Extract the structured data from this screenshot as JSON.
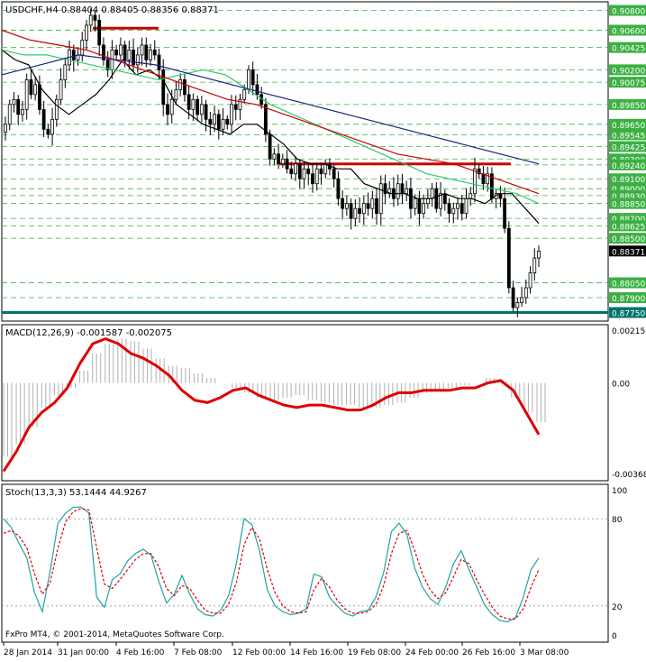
{
  "colors": {
    "background": "#ffffff",
    "frame": "#000000",
    "grid_h": "#3cb043",
    "candle": "#000000",
    "ma_fast": "#000000",
    "ma_green": "#2ecc71",
    "ma_red": "#cc0000",
    "ma_blue": "#1a237e",
    "support_line": "#00736e",
    "price_box": "#000000",
    "macd_hist": "#b0b0b0",
    "macd_signal": "#e00000",
    "stoch_main": "#1fa3a3",
    "stoch_signal": "#e00000",
    "hline": "#cc0000"
  },
  "main": {
    "header": "USDCHF,H4  0.88404 0.88405 0.88356 0.88371",
    "price_labels": [
      "0.90800",
      "0.90600",
      "0.90425",
      "0.90200",
      "0.90075",
      "0.89850",
      "0.89650",
      "0.89545",
      "0.89425",
      "0.89300",
      "0.89240",
      "0.89100",
      "0.89000",
      "0.88930",
      "0.88850",
      "0.88700",
      "0.88625",
      "0.88500",
      "0.88371",
      "0.88050",
      "0.87900",
      "0.87750"
    ],
    "current_price": "0.88371",
    "support_price": "0.87750"
  },
  "macd": {
    "header": "MACD(12,26,9) -0.001587 -0.002075",
    "labels": [
      "0.002153",
      "0.00",
      "-0.003688"
    ]
  },
  "stoch": {
    "header": "Stoch(13,3,3) 53.1444 44.9267",
    "labels": [
      "100",
      "80",
      "20",
      "0"
    ],
    "footer": "FxPro MT4, © 2001-2014, MetaQuotes Software Corp."
  },
  "time_axis": [
    "28 Jan 2014",
    "31 Jan 00:00",
    "4 Feb 16:00",
    "7 Feb 08:00",
    "12 Feb 00:00",
    "14 Feb 16:00",
    "19 Feb 08:00",
    "24 Feb 00:00",
    "26 Feb 16:00",
    "3 Mar 08:00"
  ],
  "chart_data": [
    {
      "type": "candlestick",
      "title": "USDCHF,H4",
      "x_ticks": [
        "28 Jan 2014",
        "31 Jan 00:00",
        "4 Feb 16:00",
        "7 Feb 08:00",
        "12 Feb 00:00",
        "14 Feb 16:00",
        "19 Feb 08:00",
        "24 Feb 00:00",
        "26 Feb 16:00",
        "3 Mar 08:00"
      ],
      "ylim": [
        0.877,
        0.9085
      ],
      "close": [
        0.8965,
        0.8985,
        0.899,
        0.8975,
        0.898,
        0.901,
        0.8995,
        0.9005,
        0.898,
        0.896,
        0.8955,
        0.897,
        0.899,
        0.901,
        0.9025,
        0.904,
        0.903,
        0.9035,
        0.905,
        0.9065,
        0.9075,
        0.907,
        0.9045,
        0.903,
        0.902,
        0.904,
        0.9035,
        0.9045,
        0.903,
        0.904,
        0.9025,
        0.9035,
        0.9045,
        0.903,
        0.904,
        0.9035,
        0.902,
        0.8985,
        0.8975,
        0.899,
        0.9,
        0.901,
        0.8995,
        0.898,
        0.899,
        0.8975,
        0.8985,
        0.897,
        0.8965,
        0.8975,
        0.896,
        0.897,
        0.8965,
        0.8985,
        0.898,
        0.899,
        0.9,
        0.902,
        0.9005,
        0.8995,
        0.8985,
        0.8955,
        0.893,
        0.8935,
        0.8925,
        0.893,
        0.892,
        0.8915,
        0.8925,
        0.891,
        0.892,
        0.8915,
        0.8905,
        0.892,
        0.8915,
        0.8925,
        0.892,
        0.891,
        0.889,
        0.888,
        0.8885,
        0.887,
        0.888,
        0.8875,
        0.8885,
        0.888,
        0.889,
        0.8875,
        0.8905,
        0.8895,
        0.89,
        0.889,
        0.8905,
        0.8895,
        0.89,
        0.888,
        0.889,
        0.8875,
        0.8885,
        0.889,
        0.89,
        0.888,
        0.8895,
        0.8885,
        0.8875,
        0.888,
        0.8885,
        0.8875,
        0.889,
        0.8895,
        0.892,
        0.8915,
        0.8905,
        0.8915,
        0.889,
        0.8895,
        0.889,
        0.886,
        0.88,
        0.878,
        0.8785,
        0.879,
        0.88,
        0.8815,
        0.883,
        0.8837
      ],
      "series": [
        {
          "values": [
            0.904,
            0.903,
            0.9025,
            0.9,
            0.8985,
            0.8975,
            0.8985,
            0.8995,
            0.901,
            0.903,
            0.9015,
            0.902,
            0.901,
            0.8985,
            0.8975,
            0.8965,
            0.896,
            0.8955,
            0.8965,
            0.8965,
            0.8955,
            0.8945,
            0.893,
            0.8925,
            0.8925,
            0.892,
            0.892,
            0.8905,
            0.89,
            0.8895,
            0.8895,
            0.889,
            0.889,
            0.8895,
            0.889,
            0.889,
            0.8885,
            0.8895,
            0.8895,
            0.888,
            0.8865
          ]
        },
        {
          "values": [
            0.904,
            0.9035,
            0.9035,
            0.903,
            0.9025,
            0.902,
            0.9015,
            0.901,
            0.9015,
            0.902,
            0.9015,
            0.9,
            0.8985,
            0.8975,
            0.8965,
            0.8955,
            0.8945,
            0.8935,
            0.8925,
            0.8915,
            0.891,
            0.8905,
            0.89,
            0.8895,
            0.8885
          ]
        },
        {
          "values": [
            0.906,
            0.905,
            0.9045,
            0.904,
            0.903,
            0.902,
            0.901,
            0.9,
            0.899,
            0.8985,
            0.8975,
            0.8965,
            0.8955,
            0.8945,
            0.8935,
            0.893,
            0.8925,
            0.8915,
            0.8905,
            0.8895
          ]
        },
        {
          "values": [
            0.9015,
            0.9025,
            0.9035,
            0.903,
            0.9025,
            0.9015,
            0.9005,
            0.8995,
            0.8985,
            0.8975,
            0.8965,
            0.8955,
            0.8945,
            0.8935,
            0.8925
          ]
        }
      ],
      "hlines": [
        0.9062,
        0.8925,
        0.8775
      ]
    },
    {
      "type": "bar",
      "title": "MACD(12,26,9) -0.001587 -0.002075",
      "ylim": [
        -0.003688,
        0.002153
      ],
      "histogram": [
        -0.003,
        -0.0025,
        -0.0018,
        -0.001,
        -0.0005,
        -0.0002,
        0.0005,
        0.0012,
        0.0016,
        0.0018,
        0.0017,
        0.0014,
        0.001,
        0.0007,
        0.0006,
        0.0004,
        0.0002,
        0.0,
        -0.0002,
        -0.0004,
        -0.0006,
        -0.0007,
        -0.0006,
        -0.0005,
        -0.0007,
        -0.0008,
        -0.0009,
        -0.0009,
        -0.001,
        -0.001,
        -0.0009,
        -0.0008,
        -0.0006,
        -0.0004,
        -0.0003,
        -0.0002,
        -0.0001,
        0.0,
        0.0002,
        0.0001,
        -0.0006,
        -0.0012,
        -0.0016
      ],
      "signal": [
        -0.0036,
        -0.0028,
        -0.0018,
        -0.0012,
        -0.0008,
        -0.0002,
        0.0008,
        0.0016,
        0.0018,
        0.0016,
        0.0012,
        0.001,
        0.0007,
        0.0003,
        -0.0003,
        -0.0007,
        -0.0008,
        -0.0006,
        -0.0003,
        -0.0002,
        -0.0005,
        -0.0007,
        -0.0009,
        -0.001,
        -0.0009,
        -0.0009,
        -0.001,
        -0.0011,
        -0.0011,
        -0.0009,
        -0.0006,
        -0.0004,
        -0.0004,
        -0.0003,
        -0.0003,
        -0.0003,
        -0.0002,
        -0.0002,
        0.0,
        0.0001,
        -0.0003,
        -0.0012,
        -0.0021
      ]
    },
    {
      "type": "line",
      "title": "Stoch(13,3,3) 53.1444 44.9267",
      "ylim": [
        0,
        100
      ],
      "series": [
        {
          "values": [
            80,
            74,
            63,
            53,
            29,
            16,
            44,
            77,
            84,
            88,
            88,
            84,
            26,
            19,
            38,
            42,
            51,
            56,
            59,
            55,
            37,
            22,
            28,
            41,
            28,
            18,
            14,
            13,
            17,
            27,
            49,
            80,
            76,
            58,
            31,
            20,
            16,
            14,
            15,
            18,
            42,
            40,
            26,
            20,
            15,
            13,
            16,
            17,
            26,
            43,
            71,
            77,
            69,
            46,
            33,
            25,
            21,
            33,
            49,
            58,
            45,
            33,
            21,
            14,
            10,
            9,
            12,
            26,
            45,
            53
          ]
        },
        {
          "values": [
            70,
            72,
            68,
            60,
            42,
            28,
            36,
            60,
            78,
            85,
            87,
            86,
            60,
            35,
            32,
            38,
            45,
            52,
            56,
            56,
            47,
            32,
            27,
            34,
            32,
            24,
            17,
            15,
            15,
            21,
            36,
            62,
            74,
            66,
            45,
            29,
            20,
            16,
            15,
            16,
            31,
            39,
            33,
            24,
            18,
            15,
            15,
            16,
            21,
            34,
            56,
            70,
            72,
            58,
            42,
            31,
            25,
            29,
            40,
            52,
            49,
            38,
            28,
            19,
            13,
            11,
            11,
            18,
            33,
            45
          ]
        }
      ],
      "hlines": [
        80,
        20
      ]
    }
  ]
}
